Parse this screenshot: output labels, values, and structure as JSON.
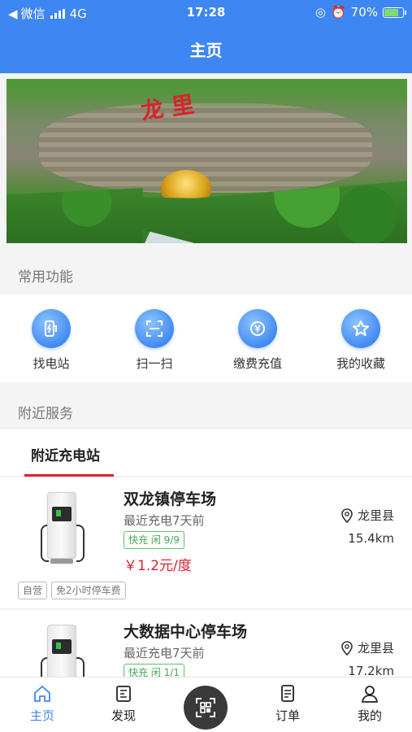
{
  "status": {
    "carrier": "微信",
    "network": "4G",
    "time": "17:28",
    "battery": "70%",
    "battery_level": 0.7
  },
  "header": {
    "title": "主页"
  },
  "banner": {
    "inscription": "龙  里"
  },
  "sections": {
    "common": "常用功能",
    "nearby": "附近服务"
  },
  "functions": [
    {
      "label": "找电站",
      "icon": "charging-station-icon"
    },
    {
      "label": "扫一扫",
      "icon": "scan-icon"
    },
    {
      "label": "缴费充值",
      "icon": "recharge-yuan-icon"
    },
    {
      "label": "我的收藏",
      "icon": "star-icon"
    }
  ],
  "nearby_tab": {
    "label": "附近充电站"
  },
  "stations": [
    {
      "name": "双龙镇停车场",
      "last_charge": "最近充电7天前",
      "fast_badge": "快充 闲 9/9",
      "price": "￥1.2元/度",
      "location": "龙里县",
      "distance": "15.4km",
      "tags": [
        "自营",
        "免2小时停车费"
      ]
    },
    {
      "name": "大数据中心停车场",
      "last_charge": "最近充电7天前",
      "fast_badge": "快充 闲 1/1",
      "location": "龙里县",
      "distance": "17.2km"
    }
  ],
  "nav": {
    "home": "主页",
    "discover": "发现",
    "orders": "订单",
    "mine": "我的"
  },
  "colors": {
    "primary": "#3e86f1",
    "accent_red": "#d9232a",
    "green": "#45a957"
  }
}
